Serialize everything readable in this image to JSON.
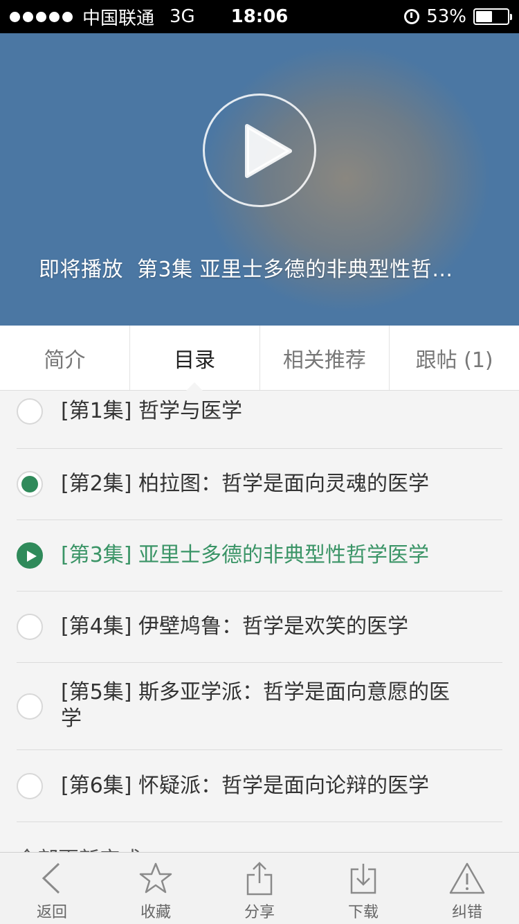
{
  "status_bar": {
    "carrier": "中国联通",
    "network": "3G",
    "time": "18:06",
    "battery": "53%",
    "battery_level": 0.53
  },
  "video": {
    "caption_prefix": "即将播放",
    "caption_title": "第3集 亚里士多德的非典型性哲…"
  },
  "tabs": [
    {
      "label": "简介",
      "active": false
    },
    {
      "label": "目录",
      "active": true
    },
    {
      "label": "相关推荐",
      "active": false
    },
    {
      "label": "跟帖 (1)",
      "active": false
    }
  ],
  "episodes": [
    {
      "title": "[第1集] 哲学与医学",
      "state": "partial"
    },
    {
      "title": "[第2集] 柏拉图：哲学是面向灵魂的医学",
      "state": "done"
    },
    {
      "title": "[第3集] 亚里士多德的非典型性哲学医学",
      "state": "playing"
    },
    {
      "title": "[第4集] 伊壁鸠鲁：哲学是欢笑的医学",
      "state": "none"
    },
    {
      "title": "[第5集] 斯多亚学派：哲学是面向意愿的医学",
      "state": "none"
    },
    {
      "title": "[第6集] 怀疑派：哲学是面向论辩的医学",
      "state": "none"
    }
  ],
  "list_more": "全部更新完成",
  "toolbar": {
    "back": "返回",
    "favorite": "收藏",
    "share": "分享",
    "download": "下载",
    "report": "纠错"
  },
  "colors": {
    "accent_green": "#3a9466",
    "video_blue": "#4a7aa8"
  }
}
